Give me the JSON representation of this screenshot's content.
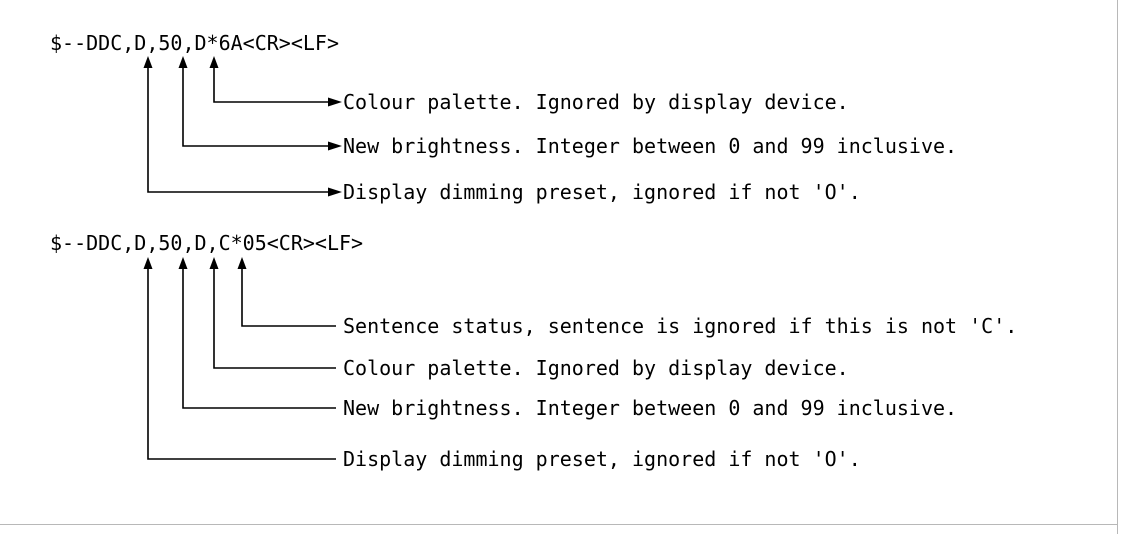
{
  "diagram": {
    "examples": [
      {
        "sentence": "$--DDC,D,50,D*6A<CR><LF>",
        "annotations": [
          {
            "field": "colour-palette",
            "text": "Colour palette. Ignored by display device.",
            "pointer": "arrow"
          },
          {
            "field": "new-brightness",
            "text": "New brightness. Integer between 0 and 99 inclusive.",
            "pointer": "arrow"
          },
          {
            "field": "dimming-preset",
            "text": "Display dimming preset, ignored if not 'O'.",
            "pointer": "arrow"
          }
        ]
      },
      {
        "sentence": "$--DDC,D,50,D,C*05<CR><LF>",
        "annotations": [
          {
            "field": "sentence-status",
            "text": "Sentence status, sentence is ignored if this is not 'C'.",
            "pointer": "line"
          },
          {
            "field": "colour-palette",
            "text": "Colour palette. Ignored by display device.",
            "pointer": "line"
          },
          {
            "field": "new-brightness",
            "text": "New brightness. Integer between 0 and 99 inclusive.",
            "pointer": "line"
          },
          {
            "field": "dimming-preset",
            "text": "Display dimming preset, ignored if not 'O'.",
            "pointer": "line"
          }
        ]
      }
    ]
  }
}
